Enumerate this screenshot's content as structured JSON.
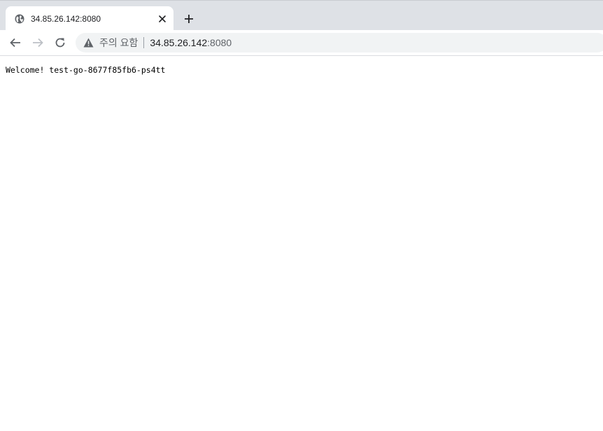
{
  "tab": {
    "title": "34.85.26.142:8080",
    "favicon_icon": "globe-icon",
    "close_icon": "close-icon"
  },
  "new_tab_icon": "plus-icon",
  "toolbar": {
    "back_icon": "back-arrow-icon",
    "forward_icon": "forward-arrow-icon",
    "reload_icon": "reload-icon"
  },
  "omnibox": {
    "security_icon": "warning-icon",
    "security_label": "주의 요함",
    "url_host": "34.85.26.142",
    "url_port": ":8080"
  },
  "page": {
    "body_text": "Welcome! test-go-8677f85fb6-ps4tt"
  },
  "colors": {
    "tabstrip_bg": "#dee1e6",
    "omnibox_bg": "#f1f3f4",
    "icon_gray": "#5f6368",
    "disabled_gray": "#9aa0a6"
  }
}
